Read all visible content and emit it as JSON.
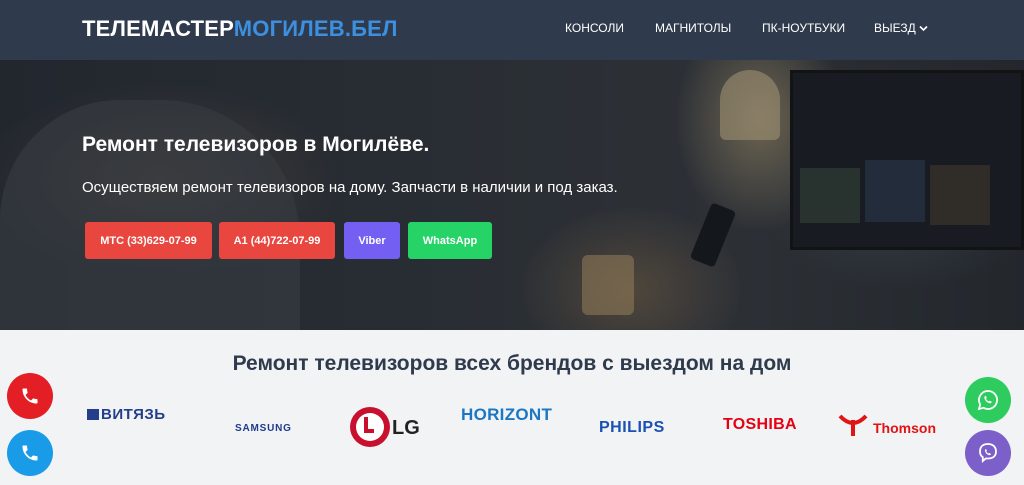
{
  "header": {
    "logo_white": "ТЕЛЕМАСТЕР",
    "logo_blue": "МОГИЛЕВ.БЕЛ",
    "nav": [
      {
        "label": "КОНСОЛИ"
      },
      {
        "label": "МАГНИТОЛЫ"
      },
      {
        "label": "ПК-НОУТБУКИ"
      },
      {
        "label": "ВЫЕЗД",
        "icon": "chevron-down-icon"
      }
    ]
  },
  "hero": {
    "title": "Ремонт телевизоров в Могилёве.",
    "subtitle": "Осуществяем ремонт телевизоров на дому. Запчасти в наличии и под заказ.",
    "buttons": {
      "mts": "МТС (33)629-07-99",
      "a1": "А1 (44)722-07-99",
      "viber": "Viber",
      "whatsapp": "WhatsApp"
    }
  },
  "brands": {
    "title": "Ремонт телевизоров всех брендов с выездом на дом",
    "vityaz": "ВИТЯЗЬ",
    "samsung": "SAMSUNG",
    "lg": "LG",
    "horizont": "HORIZONT",
    "philips": "PHILIPS",
    "toshiba": "TOSHIBA",
    "thomson": "Thomson"
  },
  "colors": {
    "header_bg": "#2f3b4c",
    "logo_accent": "#3d8fe0",
    "red_button": "#e8463e",
    "viber": "#7360f2",
    "whatsapp": "#25d366"
  }
}
